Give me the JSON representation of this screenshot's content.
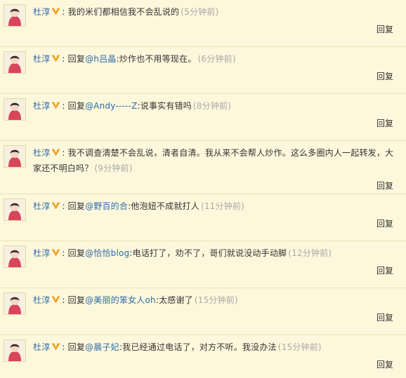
{
  "comments": [
    {
      "user": "杜淳",
      "colon": ":",
      "prefix": "",
      "mention": "",
      "mention_colon": "",
      "content": "我的米们都相信我不会乱说的",
      "time": "(5分钟前)",
      "reply_label": "回复"
    },
    {
      "user": "杜淳",
      "colon": ":",
      "prefix": "回复",
      "mention": "@h吕晶",
      "mention_colon": ":",
      "content": "炒作也不用等现在。",
      "time": "(6分钟前)",
      "reply_label": "回复"
    },
    {
      "user": "杜淳",
      "colon": ":",
      "prefix": "回复",
      "mention": "@Andy-----Z",
      "mention_colon": ":",
      "content": "说事实有错吗",
      "time": "(8分钟前)",
      "reply_label": "回复"
    },
    {
      "user": "杜淳",
      "colon": ":",
      "prefix": "",
      "mention": "",
      "mention_colon": "",
      "content": "我不调查清楚不会乱说，清者自清。我从来不会帮人炒作。这么多圈内人一起转发，大家还不明白吗？",
      "time": "(9分钟前)",
      "reply_label": "回复"
    },
    {
      "user": "杜淳",
      "colon": ":",
      "prefix": "回复",
      "mention": "@野百的合",
      "mention_colon": ":",
      "content": "他泡妞不成就打人",
      "time": "(11分钟前)",
      "reply_label": "回复"
    },
    {
      "user": "杜淳",
      "colon": ":",
      "prefix": "回复",
      "mention": "@恰恰blog",
      "mention_colon": ":",
      "content": "电话打了，劝不了，哥们就说没动手动脚",
      "time": "(12分钟前)",
      "reply_label": "回复"
    },
    {
      "user": "杜淳",
      "colon": ":",
      "prefix": "回复",
      "mention": "@美丽的笨女人oh",
      "mention_colon": ":",
      "content": "太感谢了",
      "time": "(15分钟前)",
      "reply_label": "回复"
    },
    {
      "user": "杜淳",
      "colon": ":",
      "prefix": "回复",
      "mention": "@晨子妃",
      "mention_colon": ":",
      "content": "我已经通过电话了，对方不听。我没办法",
      "time": "(15分钟前)",
      "reply_label": "回复"
    }
  ],
  "icons": {
    "avatar": "user-avatar",
    "badge": "vip-v-badge"
  },
  "colors": {
    "background": "#fdf8dc",
    "link": "#2c6aa8",
    "time": "#a8a8a8",
    "badge": "#f0a020"
  }
}
